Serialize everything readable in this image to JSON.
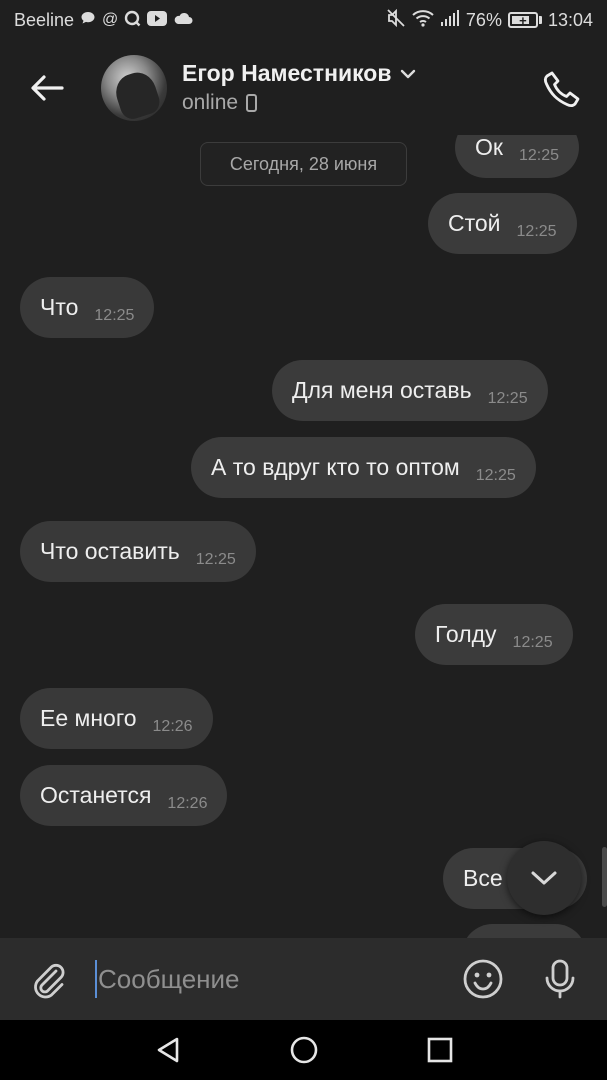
{
  "status_bar": {
    "carrier": "Beeline",
    "battery_percent": "76%",
    "battery_level": 0.76,
    "time": "13:04",
    "icons_left": [
      "chat-bubble-icon",
      "at-icon",
      "search-q-icon",
      "youtube-icon",
      "cloud-icon"
    ],
    "icons_right": [
      "mute-icon",
      "wifi-icon",
      "signal-icon",
      "battery-icon"
    ]
  },
  "header": {
    "contact_name": "Егор Наместников",
    "status": "online"
  },
  "chat": {
    "date_divider": "Сегодня, 28 июня",
    "messages": [
      {
        "direction": "out",
        "text": "Ок",
        "time": "12:25"
      },
      {
        "direction": "out",
        "text": "Стой",
        "time": "12:25"
      },
      {
        "direction": "in",
        "text": "Что",
        "time": "12:25"
      },
      {
        "direction": "out",
        "text": "Для меня оставь",
        "time": "12:25"
      },
      {
        "direction": "out",
        "text": "А то вдруг кто то оптом",
        "time": "12:25"
      },
      {
        "direction": "in",
        "text": "Что оставить",
        "time": "12:25"
      },
      {
        "direction": "out",
        "text": "Голду",
        "time": "12:25"
      },
      {
        "direction": "in",
        "text": "Ее много",
        "time": "12:26"
      },
      {
        "direction": "in",
        "text": "Останется",
        "time": "12:26"
      },
      {
        "direction": "out",
        "text": "Все",
        "time": ""
      }
    ]
  },
  "composer": {
    "placeholder": "Сообщение"
  },
  "colors": {
    "background": "#1f1f1f",
    "bubble": "#393939",
    "composer": "#2c2c2c",
    "caret": "#5b8fd6"
  }
}
